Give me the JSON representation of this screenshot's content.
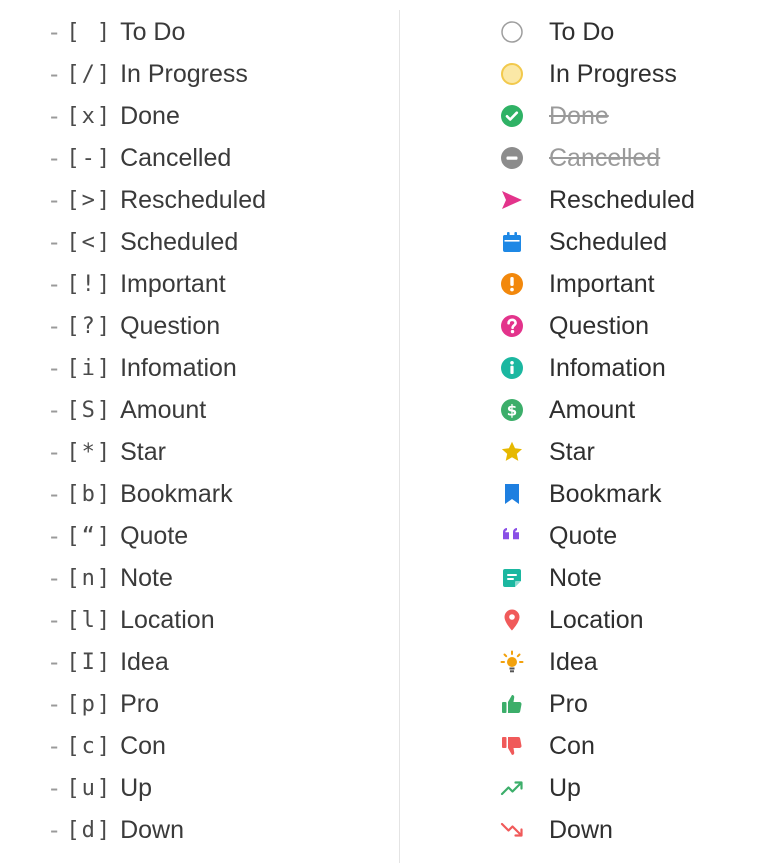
{
  "rows": [
    {
      "syntax": "[ ]",
      "label": "To Do",
      "icon": "empty-circle-icon",
      "color": "#9e9e9e"
    },
    {
      "syntax": "[/]",
      "label": "In Progress",
      "icon": "half-circle-icon",
      "color": "#f2c94c"
    },
    {
      "syntax": "[x]",
      "label": "Done",
      "icon": "check-circle-icon",
      "color": "#2fb265"
    },
    {
      "syntax": "[-]",
      "label": "Cancelled",
      "icon": "minus-circle-icon",
      "color": "#8c8c8c"
    },
    {
      "syntax": "[>]",
      "label": "Rescheduled",
      "icon": "send-arrow-icon",
      "color": "#e3338b"
    },
    {
      "syntax": "[<]",
      "label": "Scheduled",
      "icon": "calendar-icon",
      "color": "#1e88e5"
    },
    {
      "syntax": "[!]",
      "label": "Important",
      "icon": "exclamation-circle-icon",
      "color": "#f2880c"
    },
    {
      "syntax": "[?]",
      "label": "Question",
      "icon": "question-circle-icon",
      "color": "#e3338b"
    },
    {
      "syntax": "[i]",
      "label": "Infomation",
      "icon": "info-circle-icon",
      "color": "#1bb7a0"
    },
    {
      "syntax": "[S]",
      "label": "Amount",
      "icon": "dollar-circle-icon",
      "color": "#3cae6a"
    },
    {
      "syntax": "[*]",
      "label": "Star",
      "icon": "star-icon",
      "color": "#e6b800"
    },
    {
      "syntax": "[b]",
      "label": "Bookmark",
      "icon": "bookmark-icon",
      "color": "#1e7fe0"
    },
    {
      "syntax": "[“]",
      "label": "Quote",
      "icon": "quote-icon",
      "color": "#8a4fe6"
    },
    {
      "syntax": "[n]",
      "label": "Note",
      "icon": "note-icon",
      "color": "#1bb7a0"
    },
    {
      "syntax": "[l]",
      "label": "Location",
      "icon": "location-pin-icon",
      "color": "#f05a5a"
    },
    {
      "syntax": "[I]",
      "label": "Idea",
      "icon": "lightbulb-icon",
      "color": "#f2a10c"
    },
    {
      "syntax": "[p]",
      "label": "Pro",
      "icon": "thumbs-up-icon",
      "color": "#3cae6a"
    },
    {
      "syntax": "[c]",
      "label": "Con",
      "icon": "thumbs-down-icon",
      "color": "#f05a5a"
    },
    {
      "syntax": "[u]",
      "label": "Up",
      "icon": "trend-up-icon",
      "color": "#3cae6a"
    },
    {
      "syntax": "[d]",
      "label": "Down",
      "icon": "trend-down-icon",
      "color": "#f05a5a"
    }
  ],
  "dash": "-"
}
